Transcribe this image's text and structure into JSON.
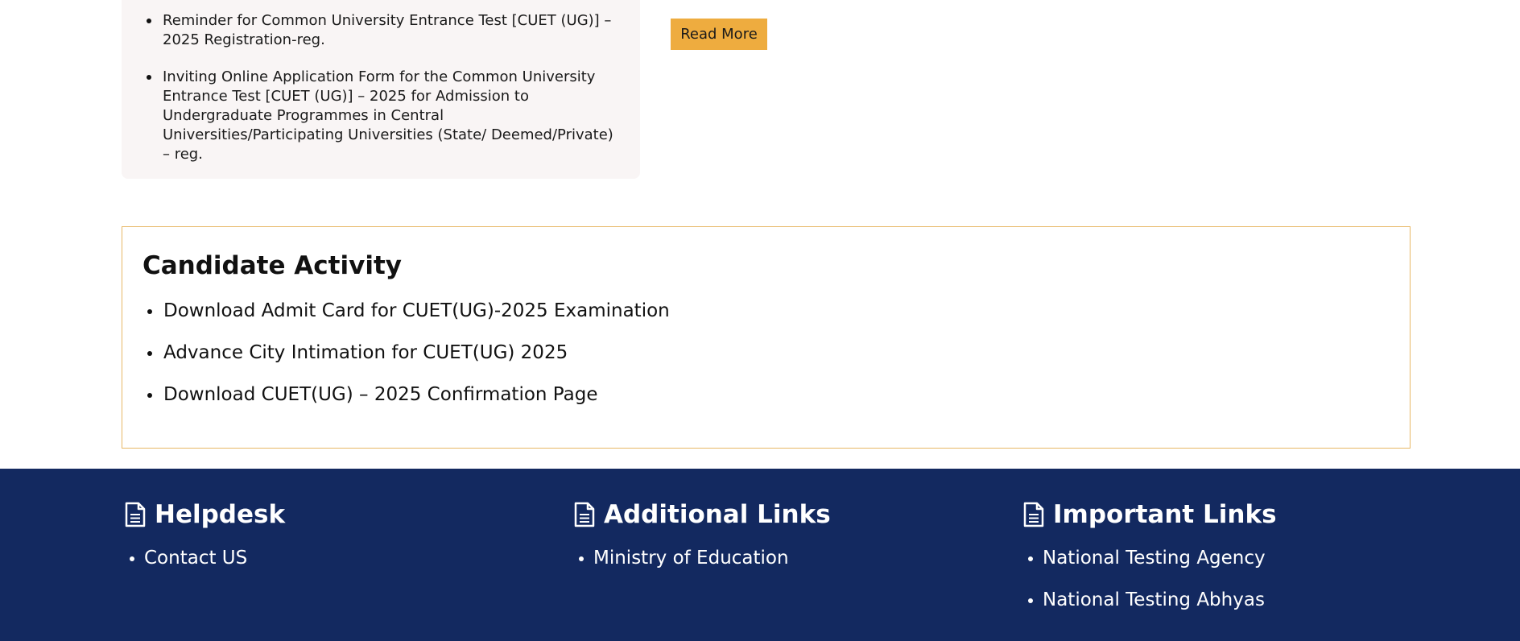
{
  "notices": {
    "items": [
      "Reminder for Common University Entrance Test [CUET (UG)] – 2025 Registration-reg.",
      "Inviting Online Application Form for the Common University Entrance Test [CUET (UG)] – 2025 for Admission to Undergraduate Programmes in Central Universities/Participating Universities (State/ Deemed/Private) – reg."
    ],
    "read_more_label": "Read More"
  },
  "candidate_activity": {
    "title": "Candidate Activity",
    "items": [
      "Download Admit Card for CUET(UG)-2025 Examination",
      "Advance City Intimation for CUET(UG) 2025",
      "Download CUET(UG) – 2025 Confirmation Page"
    ]
  },
  "footer": {
    "columns": [
      {
        "heading": "Helpdesk",
        "icon": "document-icon",
        "links": [
          "Contact US"
        ]
      },
      {
        "heading": "Additional Links",
        "icon": "document-icon",
        "links": [
          "Ministry of Education"
        ]
      },
      {
        "heading": "Important Links",
        "icon": "document-icon",
        "links": [
          "National Testing Agency",
          "National Testing Abhyas"
        ]
      }
    ]
  },
  "colors": {
    "accent": "#eeac3f",
    "footer_bg": "#132960",
    "panel_bg": "#f9f5f5",
    "box_border": "#e8b866"
  }
}
